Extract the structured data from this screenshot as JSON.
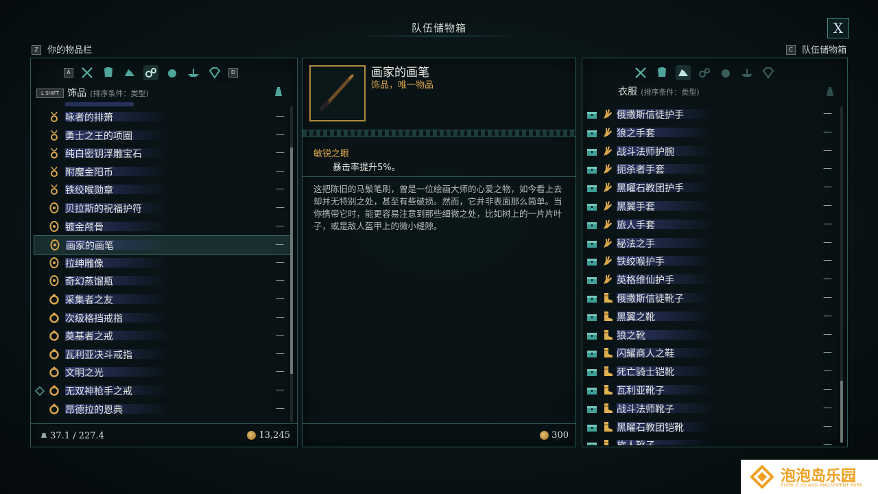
{
  "header": {
    "title": "队伍储物箱",
    "close_label": "X"
  },
  "left_header": {
    "key": "Z",
    "label": "你的物品栏"
  },
  "right_header": {
    "key": "C",
    "label": "队伍储物箱"
  },
  "left_panel": {
    "key_a": "A",
    "key_d": "D",
    "key_shift": "L SHIFT",
    "category": "饰品",
    "sort": "(排序条件：类型)",
    "items": [
      {
        "icon": "amulet-icon",
        "name": "咏者的排箫"
      },
      {
        "icon": "amulet-icon",
        "name": "勇士之王的项圈"
      },
      {
        "icon": "amulet-icon",
        "name": "纯白密钥浮雕宝石"
      },
      {
        "icon": "amulet-icon",
        "name": "附魔金阳币"
      },
      {
        "icon": "amulet-icon",
        "name": "铁绞喉勋章"
      },
      {
        "icon": "talisman-icon",
        "name": "贝拉斯的祝福护符"
      },
      {
        "icon": "talisman-icon",
        "name": "镀金颅骨"
      },
      {
        "icon": "talisman-icon",
        "name": "画家的画笔"
      },
      {
        "icon": "talisman-icon",
        "name": "拉绅雕像"
      },
      {
        "icon": "talisman-icon",
        "name": "奇幻蒸馏瓶"
      },
      {
        "icon": "ring-icon",
        "name": "采集者之友"
      },
      {
        "icon": "ring-icon",
        "name": "次级格挡戒指"
      },
      {
        "icon": "ring-icon",
        "name": "奠基者之戒"
      },
      {
        "icon": "ring-icon",
        "name": "瓦利亚决斗戒指"
      },
      {
        "icon": "ring-icon",
        "name": "文明之光"
      },
      {
        "icon": "ring-icon",
        "name": "无双神枪手之戒"
      },
      {
        "icon": "ring-icon",
        "name": "昂德拉的恩典"
      }
    ],
    "dash": "—",
    "weight": "37.1 / 227.4",
    "gold": "13,245"
  },
  "detail": {
    "name": "画家的画笔",
    "type": "饰品，唯一物品",
    "enchant_name": "敏锐之眼",
    "enchant_desc": "暴击率提升5%。",
    "description": "这把陈旧的马鬃笔刷，曾是一位绘画大师的心爱之物，如今看上去却并无特别之处，甚至有些破损。然而，它并非表面那么简单。当你携带它时，能更容易注意到那些细微之处，比如树上的一片片叶子，或是敌人盔甲上的微小缝隙。",
    "price": "300"
  },
  "right_panel": {
    "category": "衣服",
    "sort": "(排序条件：类型)",
    "items": [
      {
        "icon": "glove-icon",
        "name": "俄撒斯信徒护手"
      },
      {
        "icon": "glove-icon",
        "name": "狼之手套"
      },
      {
        "icon": "glove-icon",
        "name": "战斗法师护腕"
      },
      {
        "icon": "glove-icon",
        "name": "扼杀者手套"
      },
      {
        "icon": "glove-icon",
        "name": "黑曜石教团护手"
      },
      {
        "icon": "glove-icon",
        "name": "黑翼手套"
      },
      {
        "icon": "glove-icon",
        "name": "旅人手套"
      },
      {
        "icon": "glove-icon",
        "name": "秘法之手"
      },
      {
        "icon": "glove-icon",
        "name": "铁绞喉护手"
      },
      {
        "icon": "glove-icon",
        "name": "英格维仙护手"
      },
      {
        "icon": "boot-icon",
        "name": "俄撒斯信徒靴子"
      },
      {
        "icon": "boot-icon",
        "name": "黑翼之靴"
      },
      {
        "icon": "boot-icon",
        "name": "狼之靴"
      },
      {
        "icon": "boot-icon",
        "name": "闪耀商人之鞋"
      },
      {
        "icon": "boot-icon",
        "name": "死亡骑士铠靴"
      },
      {
        "icon": "boot-icon",
        "name": "瓦利亚靴子"
      },
      {
        "icon": "boot-icon",
        "name": "战斗法师靴子"
      },
      {
        "icon": "boot-icon",
        "name": "黑曜石教团铠靴"
      },
      {
        "icon": "boot-icon",
        "name": "旅人靴子"
      }
    ],
    "dash": "—"
  },
  "watermark": {
    "text": "泡泡岛乐园",
    "sub": "BUBBLE ISLAND AMUSEMENT PARK"
  },
  "colors": {
    "accent": "#3fa8a0",
    "gold": "#d9a54a",
    "panel_border": "#2b5c59"
  }
}
